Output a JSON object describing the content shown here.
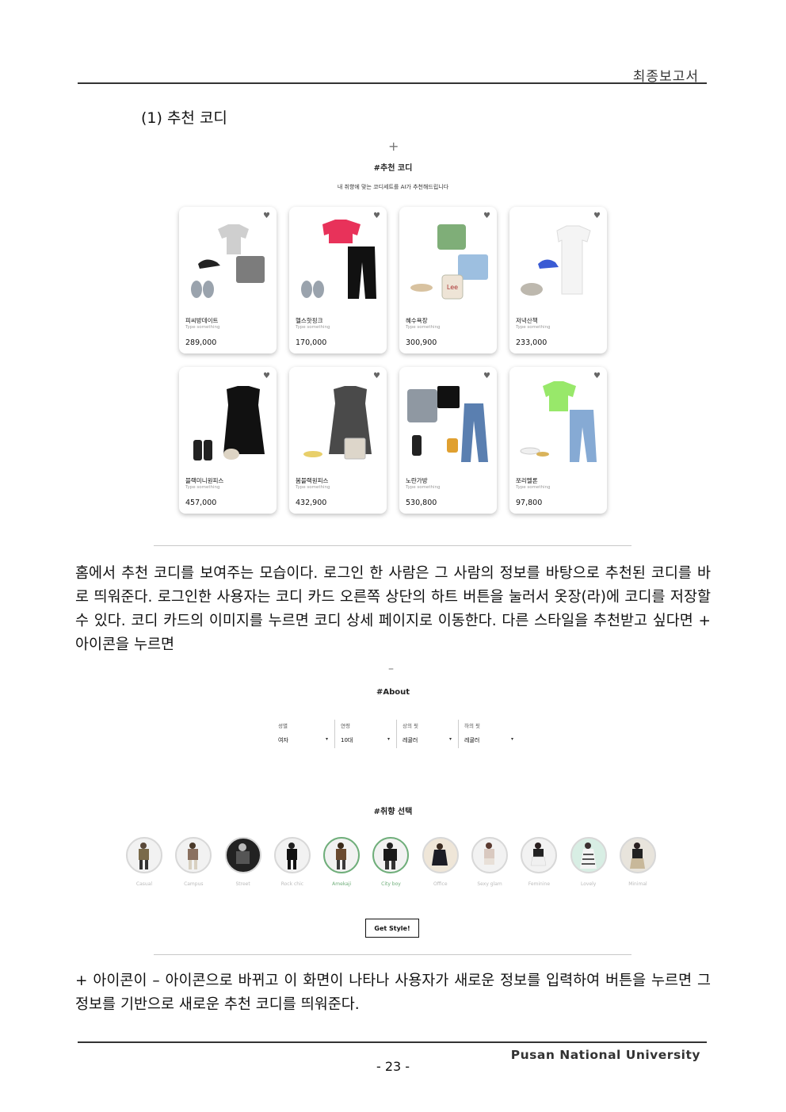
{
  "header": {
    "title": "최종보고서"
  },
  "section": {
    "title": "(1) 추천 코디"
  },
  "recommend": {
    "plus_icon": "+",
    "title": "#추천 코디",
    "subtitle": "내 취향에 맞는 코디세트를 AI가 추천해드립니다",
    "heart_icon": "♥",
    "cards": [
      {
        "name": "피씨방데이트",
        "type": "Type something",
        "price": "289,000"
      },
      {
        "name": "헬스핫핑크",
        "type": "Type something",
        "price": "170,000"
      },
      {
        "name": "혜수욕장",
        "type": "Type something",
        "price": "300,900"
      },
      {
        "name": "저녁산책",
        "type": "Type something",
        "price": "233,000"
      },
      {
        "name": "블랙미니원피스",
        "type": "Type something",
        "price": "457,000"
      },
      {
        "name": "봄블랙원피스",
        "type": "Type something",
        "price": "432,900"
      },
      {
        "name": "노란가방",
        "type": "Type something",
        "price": "530,800"
      },
      {
        "name": "쪼리멜론",
        "type": "Type something",
        "price": "97,800"
      }
    ]
  },
  "paragraph1": "홈에서 추천 코디를 보여주는 모습이다. 로그인 한 사람은 그 사람의 정보를 바탕으로 추천된 코디를 바로 띄워준다. 로그인한 사용자는 코디 카드 오른쪽 상단의 하트 버튼을 눌러서 옷장(라)에 코디를 저장할 수 있다. 코디 카드의 이미지를 누르면 코디 상세 페이지로 이동한다. 다른 스타일을 추천받고 싶다면 + 아이콘을 누르면",
  "about": {
    "minus_icon": "–",
    "title": "#About",
    "filters": [
      {
        "label": "성별",
        "value": "여자"
      },
      {
        "label": "연령",
        "value": "10대"
      },
      {
        "label": "상의 핏",
        "value": "레귤러"
      },
      {
        "label": "하의 핏",
        "value": "레귤러"
      }
    ],
    "caret": "▾",
    "taste_title": "#취향 선택",
    "styles": [
      "Casual",
      "Campus",
      "Street",
      "Rock chic",
      "Amekaji",
      "City boy",
      "Office",
      "Sexy glam",
      "Feminine",
      "Lovely",
      "Minimal"
    ],
    "selected": [
      "Amekaji",
      "City boy"
    ],
    "button": "Get Style!"
  },
  "paragraph2": "+ 아이콘이 – 아이콘으로 바뀌고 이 화면이 나타나 사용자가 새로운 정보를 입력하여 버튼을 누르면 그 정보를 기반으로 새로운 추천 코디를 띄워준다.",
  "footer": {
    "university": "Pusan National University",
    "page": "- 23 -"
  }
}
